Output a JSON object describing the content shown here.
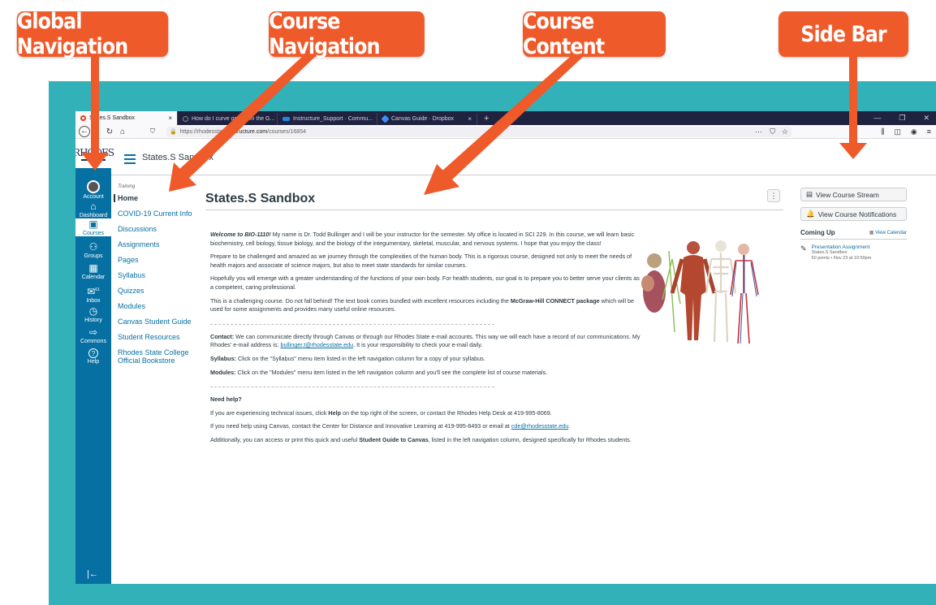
{
  "callouts": {
    "global_navigation": "Global Navigation",
    "course_navigation": "Course Navigation",
    "course_content": "Course Content",
    "side_bar": "Side Bar"
  },
  "colors": {
    "callout": "#ef5a2a",
    "frame": "#33b1b8",
    "canvas_blue": "#0770a3",
    "browser_dark": "#202340"
  },
  "browser": {
    "tabs": [
      {
        "label": "States.S Sandbox",
        "icon": "canvas-favicon-icon",
        "active": true
      },
      {
        "label": "How do I curve grades in the G...",
        "icon": "community-favicon-icon"
      },
      {
        "label": "Instructure_Support · Commu...",
        "icon": "instructure-favicon-icon"
      },
      {
        "label": "Canvas Guide · Dropbox",
        "icon": "dropbox-favicon-icon"
      }
    ],
    "close_glyph": "×",
    "new_tab_glyph": "+",
    "url_prefix": "https://rhodesstate.",
    "url_domain": "instructure.com",
    "url_path": "/courses/16854",
    "menu_glyph": "···"
  },
  "global_nav": {
    "logo": "RHODES",
    "items": [
      {
        "label": "Account",
        "icon": "account-avatar-icon"
      },
      {
        "label": "Dashboard",
        "icon": "dashboard-icon",
        "glyph": "⌂"
      },
      {
        "label": "Courses",
        "icon": "courses-icon",
        "glyph": "▣",
        "selected": true
      },
      {
        "label": "Groups",
        "icon": "groups-icon",
        "glyph": "⚇"
      },
      {
        "label": "Calendar",
        "icon": "calendar-icon",
        "glyph": "▦"
      },
      {
        "label": "Inbox",
        "icon": "inbox-icon",
        "glyph": "✉",
        "badge": "61"
      },
      {
        "label": "History",
        "icon": "history-icon",
        "glyph": "◷"
      },
      {
        "label": "Commons",
        "icon": "commons-icon",
        "glyph": "⇨"
      },
      {
        "label": "Help",
        "icon": "help-icon",
        "glyph": "?"
      }
    ],
    "collapse_glyph": "|←"
  },
  "breadcrumb": {
    "course": "States.S Sandbox"
  },
  "course_nav": {
    "subtitle": "Training",
    "items": [
      {
        "label": "Home",
        "active": true
      },
      {
        "label": "COVID-19 Current Info"
      },
      {
        "label": "Discussions"
      },
      {
        "label": "Assignments"
      },
      {
        "label": "Pages"
      },
      {
        "label": "Syllabus"
      },
      {
        "label": "Quizzes"
      },
      {
        "label": "Modules"
      },
      {
        "label": "Canvas Student Guide"
      },
      {
        "label": "Student Resources"
      },
      {
        "label": "Rhodes State College Official Bookstore"
      }
    ]
  },
  "page": {
    "title": "States.S Sandbox",
    "kebab": "⋮",
    "welcome_bold": "Welcome to BIO-1110!",
    "welcome_text": " My name is Dr. Todd Bullinger and I will be your instructor for the semester. My office is located in SCI 229. In this course, we will learn basic biochemistry, cell biology, tissue biology, and the biology of the integumentary, skeletal, muscular, and nervous systems. I hope that you enjoy the class!",
    "para2": "Prepare to be challenged and amazed as we journey through the complexities of the human body.  This is a rigorous course, designed not only to meet the needs of health majors and associate of science majors, but also to meet state standards for similar courses.",
    "para3": "Hopefully you will emerge with a greater understanding of the functions of your own body.  For health students, our goal is to prepare you to better serve your clients as a competent, caring professional.",
    "para4_a": "This is a challenging course.  Do not fall behind! The text book comes bundled with excellent resources including the ",
    "para4_bold": "McGraw-Hill CONNECT package",
    "para4_b": " which will be used for some assignments and provides many useful online resources.",
    "contact_label": "Contact:",
    "contact_text": " We can communicate directly through Canvas or through our Rhodes State e-mail accounts. This way we will each have a record of our communications. My Rhodes' e-mail address is: ",
    "contact_email": "bullinger.t@rhodesstate.edu",
    "contact_tail": ". It is your responsibility to check your e-mail daily.",
    "syllabus_label": "Syllabus:",
    "syllabus_text": " Click on the \"Syllabus\" menu item listed in the left navigation column for a copy of your syllabus.",
    "modules_label": "Modules:",
    "modules_text": "  Click on the \"Modules\" menu item listed in the left navigation column and you'll see the complete list of course materials.",
    "help_heading": "Need help?",
    "help1_a": "If you are experiencing technical issues, click ",
    "help1_bold": "Help",
    "help1_b": " on the top right of the screen, or contact the Rhodes Help Desk at 419-995-8069.",
    "help2_a": "If you need help using Canvas, contact the Center for Distance and Innovative Learning at 419-995-8493 or email at ",
    "help2_email": "cde@rhodesstate.edu",
    "help2_b": ".",
    "help3_a": "Additionally, you can access or print this quick and useful ",
    "help3_bold": "Student Guide to Canvas",
    "help3_b": ", listed in the left navigation column, designed specifically for Rhodes students."
  },
  "sidebar": {
    "stream_button": "View Course Stream",
    "notifications_button": "View Course Notifications",
    "coming_up": "Coming Up",
    "view_calendar": "View Calendar",
    "event_title": "Presentation Assignment",
    "event_course": "States.S Sandbox",
    "event_meta": "50 points • Nov 23 at 10:59pm"
  }
}
